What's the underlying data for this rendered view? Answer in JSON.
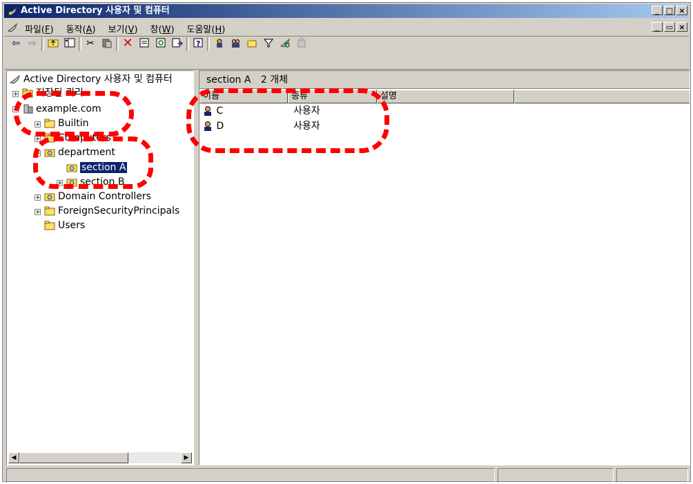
{
  "window": {
    "title": "Active Directory 사용자 및 컴퓨터",
    "caption_buttons": [
      "_",
      "□",
      "×"
    ],
    "mdi_buttons": [
      "_",
      "▭",
      "×"
    ]
  },
  "menu": {
    "items": [
      {
        "label": "파일(",
        "key": "F",
        "end": ")"
      },
      {
        "label": "동작(",
        "key": "A",
        "end": ")"
      },
      {
        "label": "보기(",
        "key": "V",
        "end": ")"
      },
      {
        "label": "창(",
        "key": "W",
        "end": ")"
      },
      {
        "label": "도움말(",
        "key": "H",
        "end": ")"
      }
    ]
  },
  "toolbar": {
    "icons": [
      "back-icon",
      "forward-icon",
      "up-folder-icon",
      "show-tree-icon",
      "cut-icon",
      "paste-icon",
      "delete-icon",
      "properties-icon",
      "refresh-icon",
      "export-icon",
      "help-icon",
      "new-user-icon",
      "new-group-icon",
      "new-ou-icon",
      "filter-icon",
      "find-icon",
      "add-to-group-icon"
    ]
  },
  "tree": {
    "root": "Active Directory 사용자 및 컴퓨터",
    "saved_queries": "저장된 쿼리",
    "domain": "example.com",
    "builtin": "Builtin",
    "computers": "Computers",
    "department": "department",
    "section_a": "section A",
    "section_b": "section B",
    "domain_controllers": "Domain Controllers",
    "foreign": "ForeignSecurityPrincipals",
    "users": "Users"
  },
  "details": {
    "header_path": "section A",
    "header_count": "2 개체",
    "columns": [
      "이름",
      "종류",
      "설명"
    ],
    "rows": [
      {
        "name": "C",
        "type": "사용자"
      },
      {
        "name": "D",
        "type": "사용자"
      }
    ]
  },
  "colors": {
    "annotation": "#ff0000",
    "title_start": "#0a246a",
    "title_end": "#a6caf0",
    "selection": "#0a246a"
  }
}
